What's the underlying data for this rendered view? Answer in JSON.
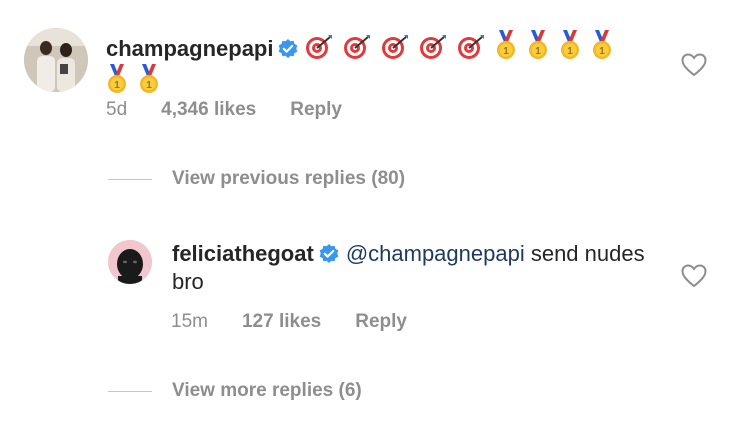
{
  "comment": {
    "username": "champagnepapi",
    "emojis": [
      "target",
      "target",
      "target",
      "target",
      "target",
      "medal",
      "medal",
      "medal",
      "medal",
      "medal",
      "medal"
    ],
    "age": "5d",
    "likes": "4,346 likes",
    "reply_label": "Reply"
  },
  "view_previous": "View previous replies (80)",
  "reply": {
    "username": "feliciathegoat",
    "mention": "@champagnepapi",
    "text": " send nudes bro",
    "age": "15m",
    "likes": "127 likes",
    "reply_label": "Reply"
  },
  "view_more": "View more replies (6)",
  "colors": {
    "verified": "#3897f0",
    "mention": "#1e3a5f",
    "meta": "#8e8e8e"
  }
}
